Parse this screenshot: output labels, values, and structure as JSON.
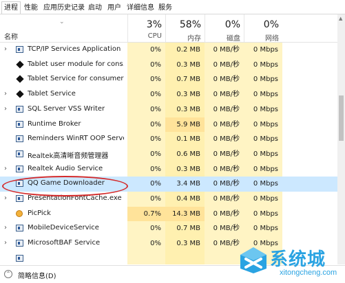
{
  "tabs": [
    "进程",
    "性能",
    "应用历史记录",
    "启动",
    "用户",
    "详细信息",
    "服务"
  ],
  "header": {
    "name_label": "名称",
    "cpu_pct": "3%",
    "cpu_label": "CPU",
    "mem_pct": "58%",
    "mem_label": "内存",
    "disk_pct": "0%",
    "disk_label": "磁盘",
    "net_pct": "0%",
    "net_label": "网络"
  },
  "rows": [
    {
      "name": "TCP/IP Services Application",
      "cpu": "0%",
      "mem": "0.2 MB",
      "disk": "0 MB/秒",
      "net": "0 Mbps",
      "expand": true,
      "icon": "window-icon"
    },
    {
      "name": "Tablet user module for cons...",
      "cpu": "0%",
      "mem": "0.3 MB",
      "disk": "0 MB/秒",
      "net": "0 Mbps",
      "expand": false,
      "icon": "pen-icon"
    },
    {
      "name": "Tablet Service for consumer ...",
      "cpu": "0%",
      "mem": "0.7 MB",
      "disk": "0 MB/秒",
      "net": "0 Mbps",
      "expand": false,
      "icon": "pen-icon"
    },
    {
      "name": "Tablet Service",
      "cpu": "0%",
      "mem": "0.3 MB",
      "disk": "0 MB/秒",
      "net": "0 Mbps",
      "expand": true,
      "icon": "pen-icon"
    },
    {
      "name": "SQL Server VSS Writer",
      "cpu": "0%",
      "mem": "0.3 MB",
      "disk": "0 MB/秒",
      "net": "0 Mbps",
      "expand": true,
      "icon": "window-icon"
    },
    {
      "name": "Runtime Broker",
      "cpu": "0%",
      "mem": "5.9 MB",
      "disk": "0 MB/秒",
      "net": "0 Mbps",
      "expand": false,
      "icon": "window-icon"
    },
    {
      "name": "Reminders WinRT OOP Server",
      "cpu": "0%",
      "mem": "0.1 MB",
      "disk": "0 MB/秒",
      "net": "0 Mbps",
      "expand": false,
      "icon": "window-icon"
    },
    {
      "name": "Realtek高清晰音频管理器",
      "cpu": "0%",
      "mem": "0.6 MB",
      "disk": "0 MB/秒",
      "net": "0 Mbps",
      "expand": false,
      "icon": "window-icon"
    },
    {
      "name": "Realtek Audio Service",
      "cpu": "0%",
      "mem": "0.3 MB",
      "disk": "0 MB/秒",
      "net": "0 Mbps",
      "expand": true,
      "icon": "window-icon"
    },
    {
      "name": "QQ Game Downloader",
      "cpu": "0%",
      "mem": "3.4 MB",
      "disk": "0 MB/秒",
      "net": "0 Mbps",
      "expand": false,
      "icon": "window-icon",
      "selected": true
    },
    {
      "name": "PresentationFontCache.exe",
      "cpu": "0%",
      "mem": "0.4 MB",
      "disk": "0 MB/秒",
      "net": "0 Mbps",
      "expand": true,
      "icon": "window-icon"
    },
    {
      "name": "PicPick",
      "cpu": "0.7%",
      "mem": "14.3 MB",
      "disk": "0 MB/秒",
      "net": "0 Mbps",
      "expand": false,
      "icon": "picpick-icon"
    },
    {
      "name": "MobileDeviceService",
      "cpu": "0%",
      "mem": "0.7 MB",
      "disk": "0 MB/秒",
      "net": "0 Mbps",
      "expand": true,
      "icon": "window-icon"
    },
    {
      "name": "MicrosoftBAF Service",
      "cpu": "0%",
      "mem": "0.3 MB",
      "disk": "0 MB/秒",
      "net": "0 Mbps",
      "expand": true,
      "icon": "window-icon"
    },
    {
      "name": "",
      "cpu": "",
      "mem": "",
      "disk": "",
      "net": "",
      "expand": false,
      "icon": "window-icon"
    }
  ],
  "footer": {
    "fewer_details": "简略信息(D)"
  },
  "watermark": {
    "brand": "系统城",
    "url": "xitongcheng.com"
  },
  "colors": {
    "selection": "#cce8ff",
    "annotation": "#d42a2a",
    "heat": "#fff4c4",
    "watermark": "#2aa3e2"
  }
}
